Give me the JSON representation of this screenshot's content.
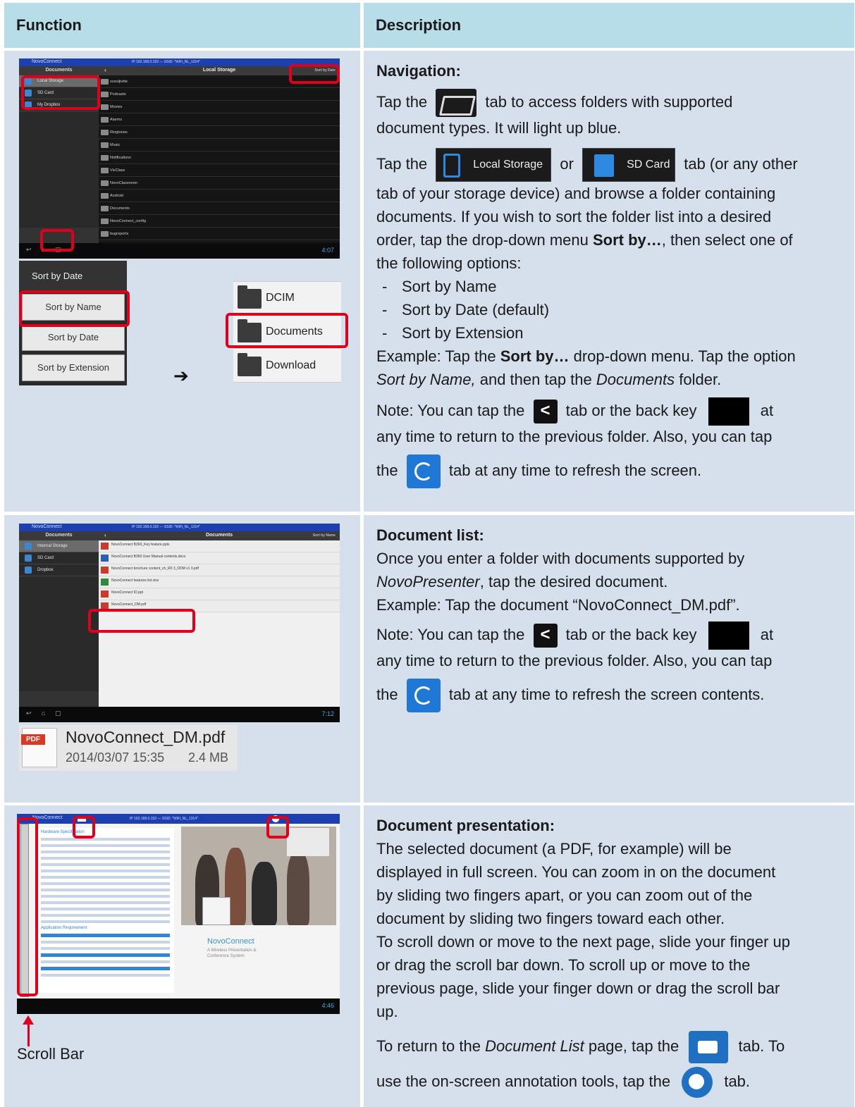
{
  "header": {
    "function": "Function",
    "description": "Description"
  },
  "row1": {
    "screen": {
      "status_title": "NovoConnect",
      "status_info": "IP 192.168.0.192 — SSID: \"WiFi_NL_1314\"",
      "sidebar_title": "Documents",
      "sidebar_items": [
        "Local Storage",
        "SD Card",
        "My Dropbox"
      ],
      "pane_title": "Local Storage",
      "sort_label": "Sort by Date",
      "folders": [
        "sosoljivitie",
        "Podcasts",
        "Movies",
        "Alarms",
        "Ringtones",
        "Music",
        "Notifications",
        "VivClass",
        "NovoClassroom",
        "Android",
        "Documents",
        "NovoConnect_config",
        "bugreports"
      ],
      "clock": "4:07"
    },
    "sort_menu": {
      "title": "Sort by Date",
      "options": [
        "Sort by Name",
        "Sort by Date",
        "Sort by Extension"
      ]
    },
    "arrow": "➔",
    "folder_list": [
      "DCIM",
      "Documents",
      "Download"
    ],
    "title": "Navigation:",
    "p1a": "Tap the",
    "p1b": "tab to access folders with supported",
    "p1c": "document types. It will light up blue.",
    "p2a": "Tap the",
    "local_storage": "Local Storage",
    "or": "or",
    "sd_card": "SD Card",
    "p2b": "tab (or any other",
    "p2c": "tab of your storage device) and browse a folder containing",
    "p2d": "documents. If you wish to sort the folder list into a desired",
    "p2e1": "order, tap the drop-down menu ",
    "p2e_bold": "Sort by…",
    "p2e2": ", then select one of",
    "p2f": "the following options:",
    "options": [
      "Sort by Name",
      "Sort by Date (default)",
      "Sort by Extension"
    ],
    "dash": "-",
    "ex1a": "Example: Tap the ",
    "ex1_bold": "Sort by…",
    "ex1b": " drop-down menu. Tap the option",
    "ex2_it1": "Sort by Name,",
    "ex2a": " and then tap the ",
    "ex2_it2": "Documents",
    "ex2b": " folder.",
    "n1a": "Note: You can tap the",
    "n1b": "tab or the back key",
    "n1c": "at",
    "n2": "any time to return to the previous folder. Also, you can tap",
    "n3a": "the",
    "n3b": "tab at any time to refresh the screen.",
    "back_glyph": "<"
  },
  "row2": {
    "screen": {
      "status_title": "NovoConnect",
      "status_info": "IP 192.168.0.192 — SSID: \"WiFi_NL_1314\"",
      "sidebar_title": "Documents",
      "sidebar_items": [
        "Internal Storage",
        "SD Card",
        "Dropbox"
      ],
      "pane_title": "Documents",
      "sort_label": "Sort by Name",
      "docs": [
        "NovoConnect B360_Key feature.pptx",
        "NovoConnect B360 User Manual contents.docx",
        "NovoConnect brochure content_ch_R0 3_DDM v1 0.pdf",
        "NovoConnect features list.xlsx",
        "NovoConnect ID.ppt",
        "NovoConnect_DM.pdf"
      ],
      "clock": "7:12"
    },
    "file": {
      "tag": "PDF",
      "name": "NovoConnect_DM.pdf",
      "date": "2014/03/07 15:35",
      "size": "2.4 MB"
    },
    "title": "Document list:",
    "l1": "Once you enter a folder with documents supported by",
    "l2_it": "NovoPresenter",
    "l2b": ", tap the desired document.",
    "l3": "Example: Tap the document “NovoConnect_DM.pdf”.",
    "n1a": "Note: You can tap the",
    "n1b": "tab or the back key",
    "n1c": "at",
    "n2": "any time to return to the previous folder. Also, you can tap",
    "n3a": "the",
    "n3b": "tab at any time to refresh the screen contents.",
    "back_glyph": "<"
  },
  "row3": {
    "screen": {
      "status_title": "NovoConnect",
      "status_info": "IP 192.168.0.192 — SSID: \"WiFi_NL_1314\"",
      "spec_title": "Hardware Specification",
      "app_title": "Application Requirement",
      "brand": "NovoConnect",
      "brand_sub1": "A Wireless Presentation &",
      "brand_sub2": "Conference System",
      "clock": "4:46"
    },
    "scroll_label": "Scroll Bar",
    "title": "Document presentation:",
    "l1": "The selected document (a PDF, for example) will be",
    "l2": "displayed in full screen. You can zoom in on the document",
    "l3": "by sliding two fingers apart, or you can zoom out of the",
    "l4": "document by sliding two fingers toward each other.",
    "l5": "To scroll down or move to the next page, slide your finger up",
    "l6": "or drag the scroll bar down. To scroll up or move to the",
    "l7": "previous page, slide your finger down or drag the scroll bar",
    "l8": "up.",
    "r1a": "To return to the ",
    "r1_it": "Document List",
    "r1b": " page, tap the",
    "r1c": "tab. To",
    "r2a": "use the on-screen annotation tools, tap the",
    "r2b": "tab."
  }
}
